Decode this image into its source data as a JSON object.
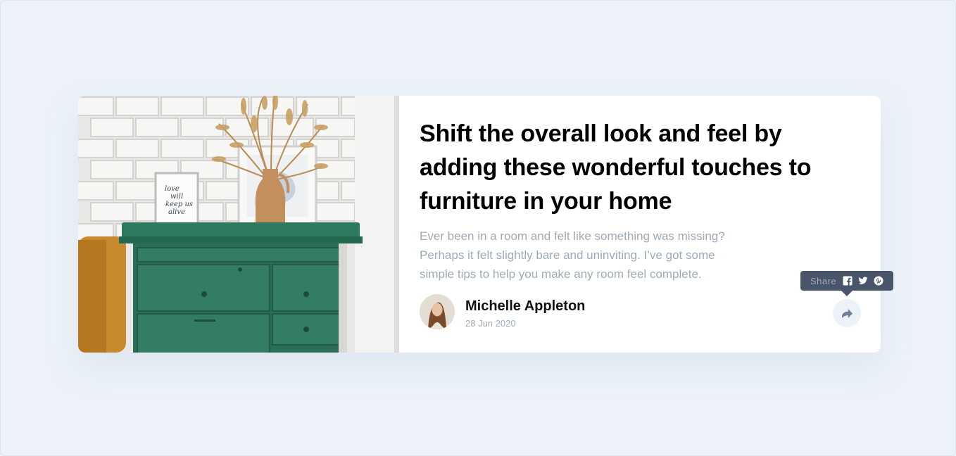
{
  "article": {
    "title": "Shift the overall look and feel by adding these wonderful touches to furniture in your home",
    "excerpt": "Ever been in a room and felt like something was missing? Perhaps it felt slightly bare and uninviting. I’ve got some simple tips to help you make any room feel complete.",
    "image_icon": "drawers-photo"
  },
  "author": {
    "name": "Michelle Appleton",
    "date": "28 Jun 2020",
    "avatar_icon": "avatar-photo"
  },
  "share": {
    "label": "Share",
    "icons": [
      "facebook-icon",
      "twitter-icon",
      "pinterest-icon"
    ],
    "button_icon": "share-icon"
  },
  "photo_text": {
    "frame_lines": [
      "love",
      "will",
      "keep us",
      "alive"
    ]
  },
  "colors": {
    "background": "#ecf2f8",
    "card": "#ffffff",
    "title": "#000000",
    "muted": "#9eaab8",
    "tooltip": "#48556a",
    "dresser": "#2b6e57"
  }
}
